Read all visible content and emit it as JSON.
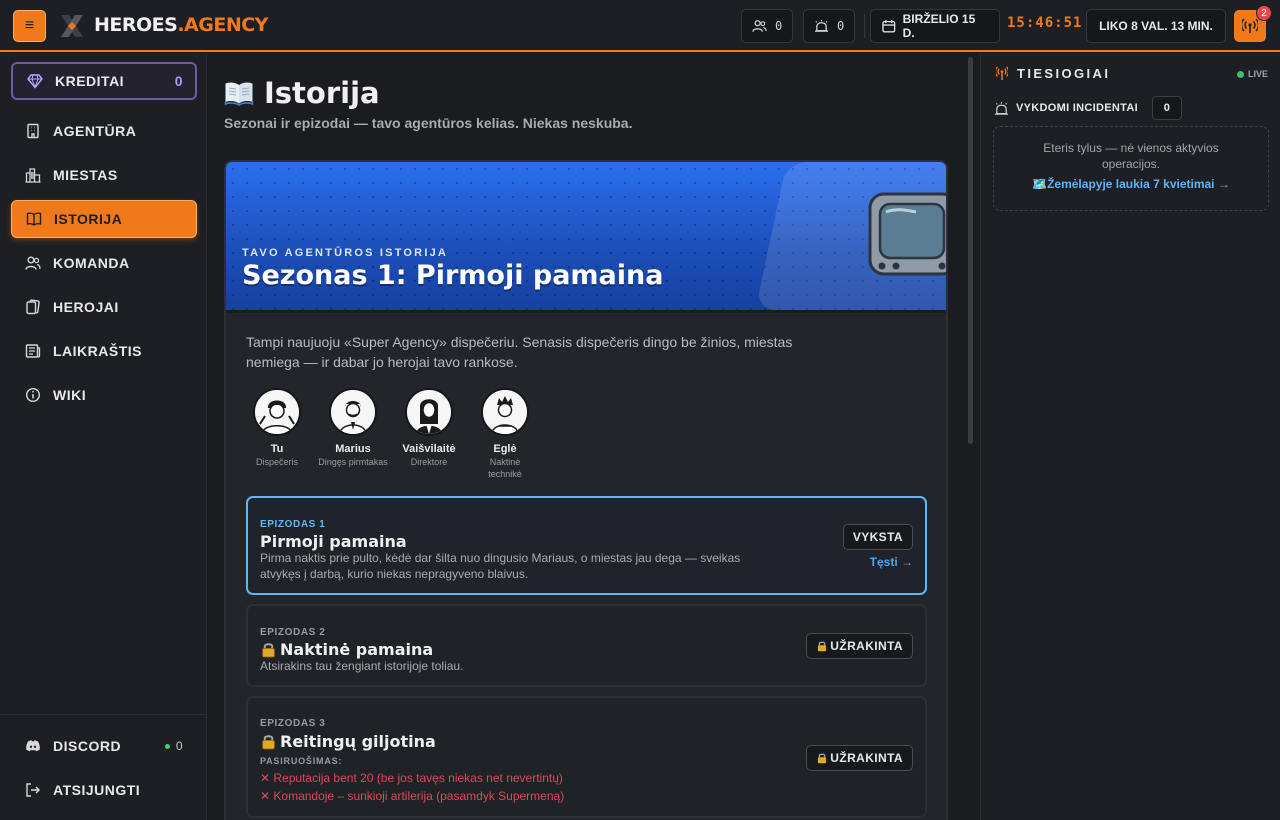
{
  "app": {
    "brand_left": "HEROES",
    "brand_right": ".AGENCY"
  },
  "topbar": {
    "menu_icon": "hamburger-icon",
    "team_count": "0",
    "alarm_count": "0",
    "date": "BIRŽELIO 15 D.",
    "clock": "15:46:51",
    "time_left": "LIKO 8 VAL. 13 MIN.",
    "notifications_badge": "2"
  },
  "sidebar": {
    "credits_label": "KREDITAI",
    "credits_value": "0",
    "items": [
      {
        "label": "AGENTŪRA",
        "icon": "building-icon"
      },
      {
        "label": "MIESTAS",
        "icon": "city-icon"
      },
      {
        "label": "ISTORIJA",
        "icon": "book-icon"
      },
      {
        "label": "KOMANDA",
        "icon": "users-icon"
      },
      {
        "label": "HEROJAI",
        "icon": "cards-icon"
      },
      {
        "label": "LAIKRAŠTIS",
        "icon": "newspaper-icon"
      },
      {
        "label": "WIKI",
        "icon": "info-icon"
      }
    ],
    "discord_label": "DISCORD",
    "discord_count": "0",
    "logout_label": "ATSIJUNGTI"
  },
  "main": {
    "title": "Istorija",
    "subtitle": "Sezonai ir epizodai — tavo agentūros kelias. Niekas neskuba.",
    "season": {
      "eyebrow": "TAVO AGENTŪROS ISTORIJA",
      "title": "Sezonas 1: Pirmoji pamaina",
      "description": "Tampi naujuoju «Super Agency» dispečeriu. Senasis dispečeris dingo be žinios, miestas nemiega — ir dabar jo herojai tavo rankose.",
      "characters": [
        {
          "name": "Tu",
          "role": "Dispečeris"
        },
        {
          "name": "Marius",
          "role": "Dingęs pirmtakas"
        },
        {
          "name": "Vaišvilaitė",
          "role": "Direktorė"
        },
        {
          "name": "Eglė",
          "role": "Naktinė technikė"
        }
      ],
      "episodes": [
        {
          "number": "EPIZODAS 1",
          "title": "Pirmoji pamaina",
          "description": "Pirma naktis prie pulto, kėdė dar šilta nuo dingusio Mariaus, o miestas jau dega — sveikas atvykęs į darbą, kurio niekas nepragyveno blaivus.",
          "status": "VYKSTA",
          "action": "Tęsti →"
        },
        {
          "number": "EPIZODAS 2",
          "title": "Naktinė pamaina",
          "description": "Atsirakins tau žengiant istorijoje toliau.",
          "status": "UŽRAKINTA"
        },
        {
          "number": "EPIZODAS 3",
          "title": "Reitingų giljotina",
          "prep_label": "PASIRUOŠIMAS:",
          "requirements": [
            "✕ Reputacija bent 20 (be jos tavęs niekas net nevertintų)",
            "✕ Komandoje – sunkioji artilerija (pasamdyk Supermeną)"
          ],
          "status": "UŽRAKINTA"
        }
      ]
    }
  },
  "live_panel": {
    "title": "TIESIOGIAI",
    "live_badge": "LIVE",
    "incidents_label": "VYKDOMI INCIDENTAI",
    "incidents_count": "0",
    "empty_text": "Eteris tylus — nė vienos aktyvios operacijos.",
    "empty_link": "🗺️Žemėlapyje laukia 7 kvietimai →"
  },
  "colors": {
    "accent": "#f07a1a",
    "credits": "#6b5ba8",
    "active_episode": "#63b6f5",
    "locked_req": "#e0475a"
  }
}
